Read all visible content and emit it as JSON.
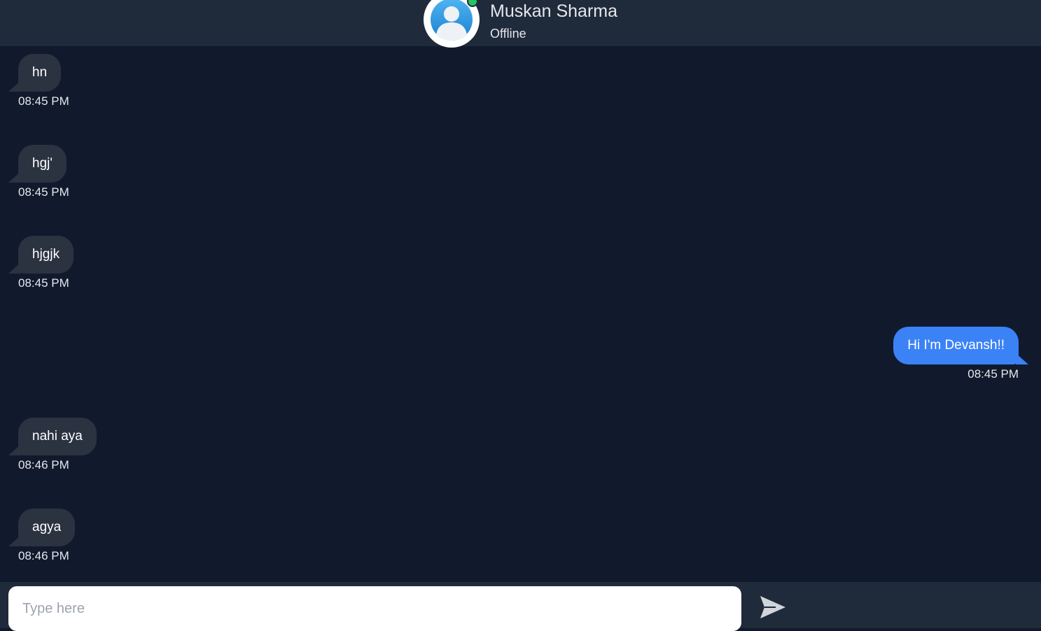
{
  "contact": {
    "name": "Muskan Sharma",
    "status": "Offline",
    "online_dot_color": "#22c55e",
    "avatar_icon": "user-avatar-icon"
  },
  "messages": [
    {
      "text": "hn",
      "time": "08:45 PM",
      "direction": "incoming"
    },
    {
      "text": "hgj'",
      "time": "08:45 PM",
      "direction": "incoming"
    },
    {
      "text": "hjgjk",
      "time": "08:45 PM",
      "direction": "incoming"
    },
    {
      "text": "Hi I'm Devansh!!",
      "time": "08:45 PM",
      "direction": "outgoing"
    },
    {
      "text": "nahi aya",
      "time": "08:46 PM",
      "direction": "incoming"
    },
    {
      "text": "agya",
      "time": "08:46 PM",
      "direction": "incoming"
    }
  ],
  "composer": {
    "placeholder": "Type here",
    "value": "",
    "send_icon": "send-icon"
  },
  "colors": {
    "background": "#111a2d",
    "header": "#1f2a3b",
    "incoming_bubble": "#2b3341",
    "outgoing_bubble": "#3b82f6"
  }
}
